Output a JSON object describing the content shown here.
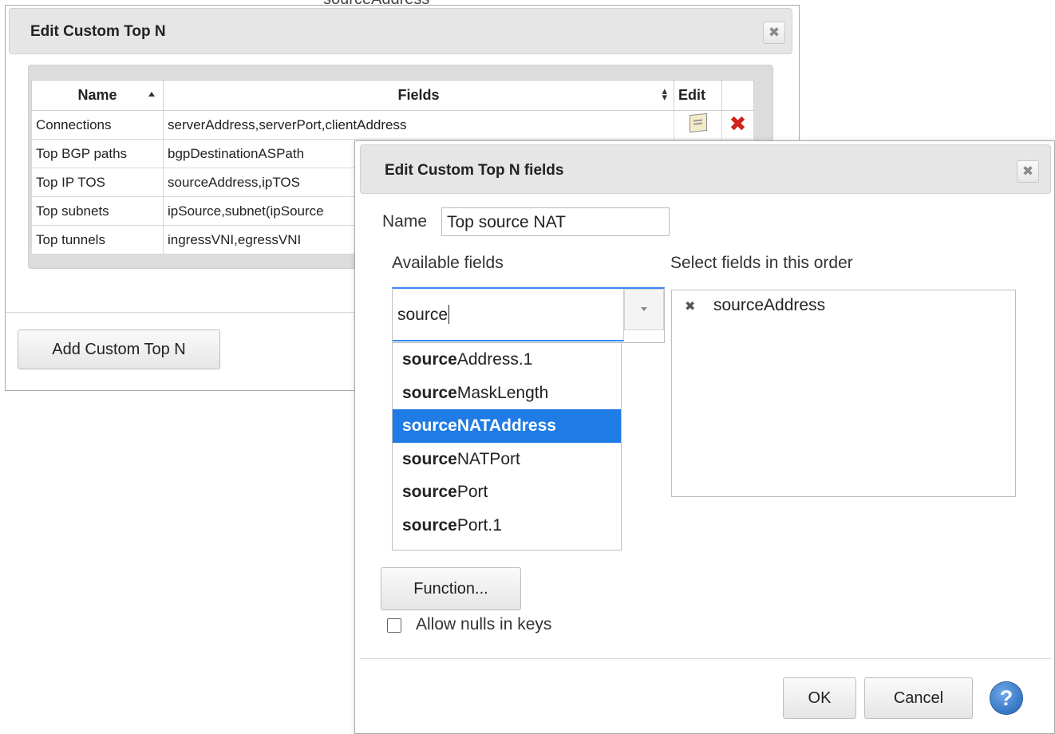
{
  "background_snippet": "sourceAddress",
  "back_dialog": {
    "title": "Edit Custom Top N",
    "close_symbol": "✖",
    "table": {
      "columns": [
        "Name",
        "Fields",
        "Edit"
      ],
      "rows": [
        {
          "name": "Connections",
          "fields": "serverAddress,serverPort,clientAddress"
        },
        {
          "name": "Top BGP paths",
          "fields": "bgpDestinationASPath"
        },
        {
          "name": "Top IP TOS",
          "fields": "sourceAddress,ipTOS"
        },
        {
          "name": "Top subnets",
          "fields": "ipSource,subnet(ipSource"
        },
        {
          "name": "Top tunnels",
          "fields": "ingressVNI,egressVNI"
        }
      ],
      "delete_symbol": "✖"
    },
    "add_button": "Add Custom Top N"
  },
  "front_dialog": {
    "title": "Edit Custom Top N fields",
    "close_symbol": "✖",
    "name_label": "Name",
    "name_value": "Top source NAT",
    "available_label": "Available fields",
    "selected_label": "Select fields in this order",
    "search_value": "source",
    "options": [
      {
        "match": "source",
        "rest": "Address.1"
      },
      {
        "match": "source",
        "rest": "MaskLength"
      },
      {
        "match": "source",
        "rest": "NATAddress"
      },
      {
        "match": "source",
        "rest": "NATPort"
      },
      {
        "match": "source",
        "rest": "Port"
      },
      {
        "match": "source",
        "rest": "Port.1"
      }
    ],
    "highlighted_option": "sourceNATAddress",
    "selected_fields": [
      {
        "remove_symbol": "✖",
        "label": "sourceAddress"
      }
    ],
    "function_button": "Function...",
    "allow_nulls_label": "Allow nulls in keys",
    "allow_nulls_checked": false,
    "ok_button": "OK",
    "cancel_button": "Cancel",
    "help_symbol": "?"
  },
  "colors": {
    "highlight": "#1f7ce6",
    "focus_border": "#3b88f4",
    "delete_red": "#d2231b"
  }
}
